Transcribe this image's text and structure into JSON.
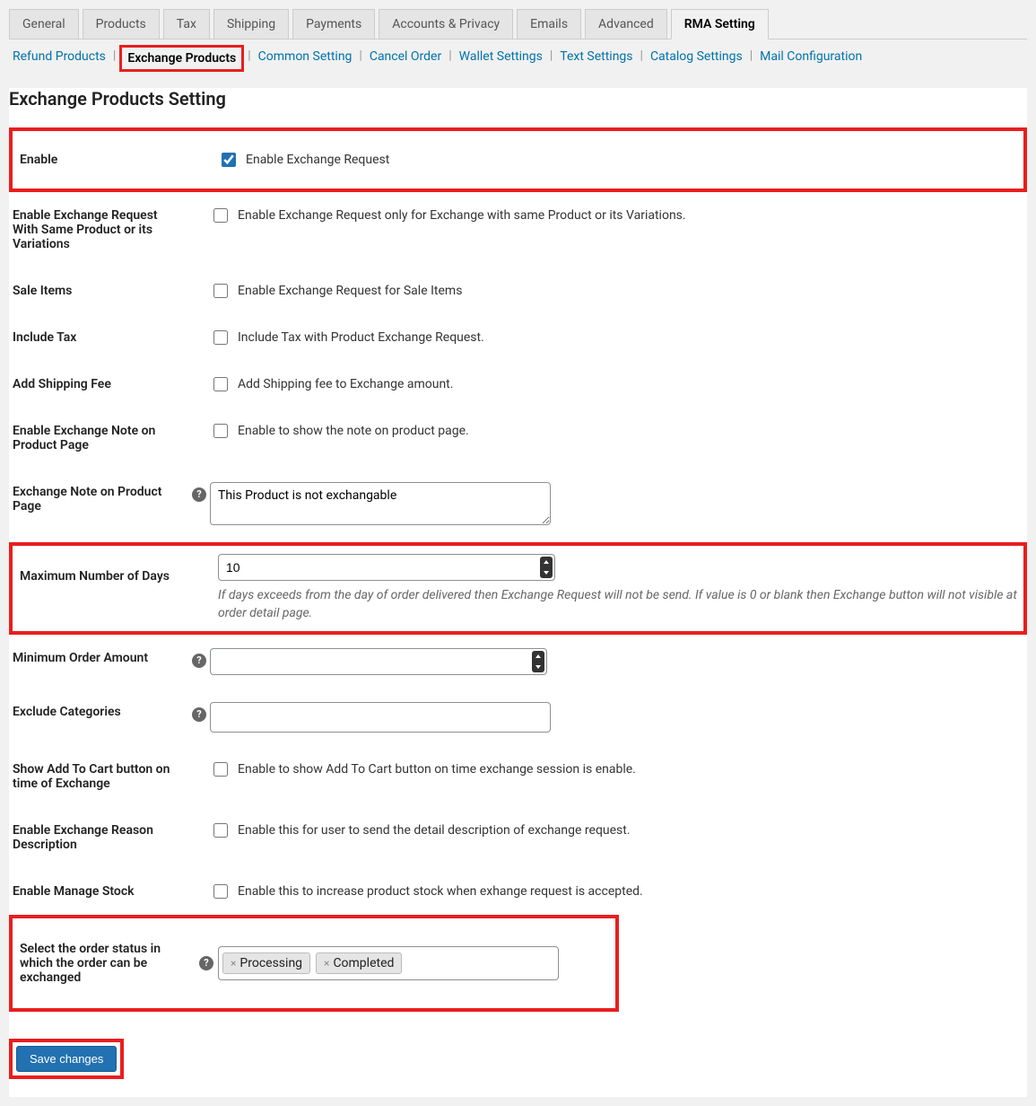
{
  "tabs": [
    "General",
    "Products",
    "Tax",
    "Shipping",
    "Payments",
    "Accounts & Privacy",
    "Emails",
    "Advanced",
    "RMA Setting"
  ],
  "active_tab": "RMA Setting",
  "subtabs": [
    "Refund Products",
    "Exchange Products",
    "Common Setting",
    "Cancel Order",
    "Wallet Settings",
    "Text Settings",
    "Catalog Settings",
    "Mail Configuration"
  ],
  "active_subtab": "Exchange Products",
  "page_title": "Exchange Products Setting",
  "rows": {
    "enable": {
      "label": "Enable",
      "text": "Enable Exchange Request",
      "checked": true
    },
    "same_product": {
      "label": "Enable Exchange Request With Same Product or its Variations",
      "text": "Enable Exchange Request only for Exchange with same Product or its Variations.",
      "checked": false
    },
    "sale_items": {
      "label": "Sale Items",
      "text": "Enable Exchange Request for Sale Items",
      "checked": false
    },
    "include_tax": {
      "label": "Include Tax",
      "text": "Include Tax with Product Exchange Request.",
      "checked": false
    },
    "shipping_fee": {
      "label": "Add Shipping Fee",
      "text": "Add Shipping fee to Exchange amount.",
      "checked": false
    },
    "note_page": {
      "label": "Enable Exchange Note on Product Page",
      "text": "Enable to show the note on product page.",
      "checked": false
    },
    "note_text": {
      "label": "Exchange Note on Product Page",
      "value": "This Product is not exchangable",
      "help": true
    },
    "max_days": {
      "label": "Maximum Number of Days",
      "value": "10",
      "desc": "If days exceeds from the day of order delivered then Exchange Request will not be send. If value is 0 or blank then Exchange button will not visible at order detail page."
    },
    "min_amount": {
      "label": "Minimum Order Amount",
      "value": "",
      "help": true
    },
    "exclude_cat": {
      "label": "Exclude Categories",
      "help": true
    },
    "add_to_cart": {
      "label": "Show Add To Cart button on time of Exchange",
      "text": "Enable to show Add To Cart button on time exchange session is enable.",
      "checked": false
    },
    "reason_desc": {
      "label": "Enable Exchange Reason Description",
      "text": "Enable this for user to send the detail description of exchange request.",
      "checked": false
    },
    "manage_stock": {
      "label": "Enable Manage Stock",
      "text": "Enable this to increase product stock when exhange request is accepted.",
      "checked": false
    },
    "order_status": {
      "label": "Select the order status in which the order can be exchanged",
      "chips": [
        "Processing",
        "Completed"
      ],
      "help": true
    }
  },
  "save_label": "Save changes"
}
